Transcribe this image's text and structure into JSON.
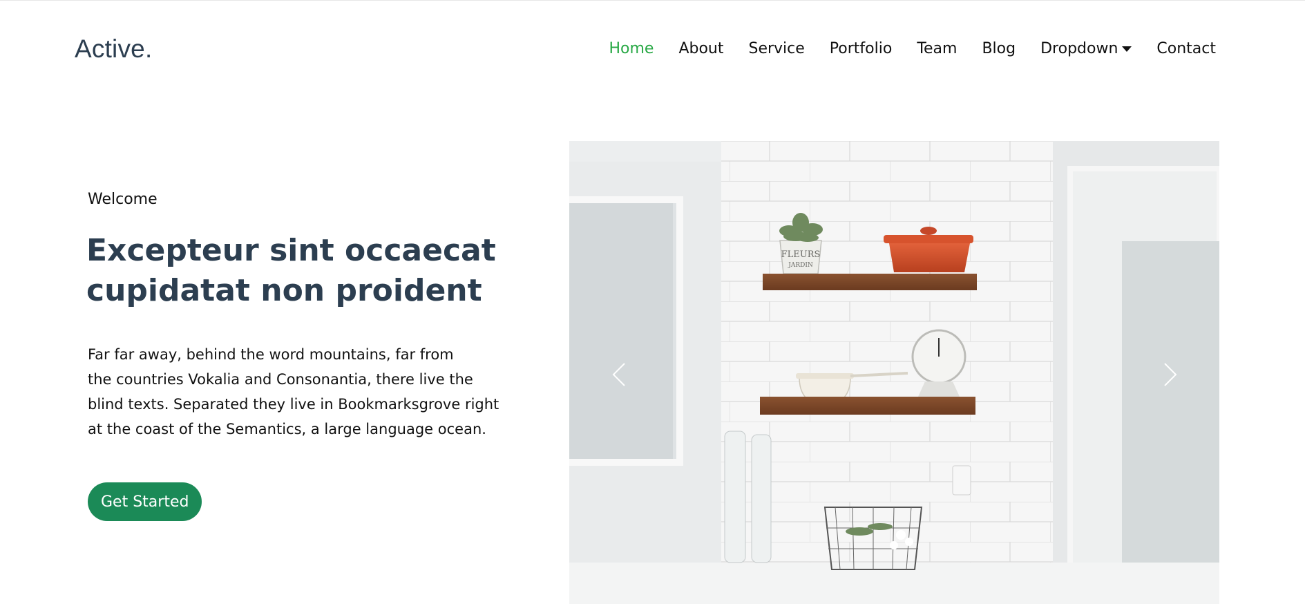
{
  "header": {
    "brand": "Active.",
    "nav": [
      {
        "label": "Home",
        "active": true
      },
      {
        "label": "About"
      },
      {
        "label": "Service"
      },
      {
        "label": "Portfolio"
      },
      {
        "label": "Team"
      },
      {
        "label": "Blog"
      },
      {
        "label": "Dropdown",
        "has_caret": true
      },
      {
        "label": "Contact"
      }
    ]
  },
  "hero": {
    "eyebrow": "Welcome",
    "title_lines": [
      "Excepteur sint occaecat",
      "cupidatat non proident"
    ],
    "paragraph_lines": [
      "Far far away, behind the word mountains, far from",
      "the countries Vokalia and Consonantia, there live the",
      "blind texts. Separated they live in Bookmarksgrove right",
      "at the coast of the Semantics, a large language ocean."
    ],
    "cta_label": "Get Started"
  },
  "carousel": {
    "image_description_icon": "kitchen-shelves-image",
    "pot_text_line1": "FLEURS",
    "pot_text_line2": "JARDIN",
    "prev_icon": "chevron-left-icon",
    "next_icon": "chevron-right-icon"
  },
  "colors": {
    "brand": "#2c3e50",
    "nav_active": "#27a844",
    "cta_bg": "#1b8a57",
    "heading": "#2c3e50"
  }
}
